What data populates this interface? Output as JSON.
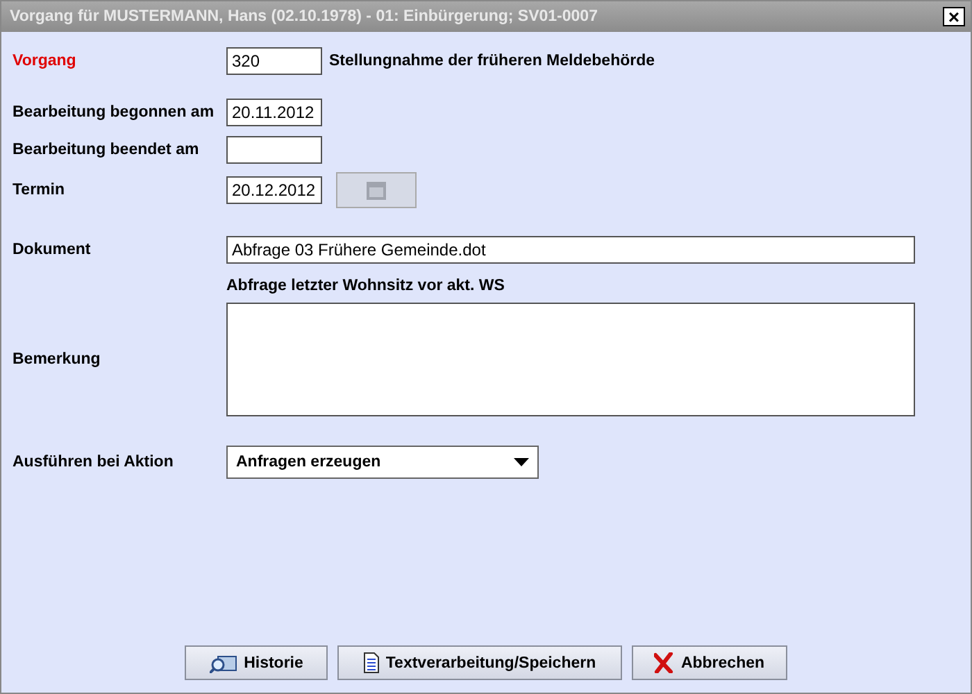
{
  "window": {
    "title": "Vorgang für MUSTERMANN, Hans (02.10.1978) - 01: Einbürgerung; SV01-0007",
    "close": "×"
  },
  "vorgang": {
    "label": "Vorgang",
    "value": "320",
    "description": "Stellungnahme der früheren Meldebehörde"
  },
  "begonnen": {
    "label": "Bearbeitung begonnen am",
    "value": "20.11.2012"
  },
  "beendet": {
    "label": "Bearbeitung beendet am"
  },
  "termin": {
    "label": "Termin",
    "value": "20.12.2012",
    "calendar_disabled": true
  },
  "dokument": {
    "label": "Dokument",
    "value": "Abfrage 03 Frühere Gemeinde.dot",
    "note": "Abfrage letzter Wohnsitz vor akt. WS"
  },
  "bemerkung": {
    "label": "Bemerkung"
  },
  "aktion": {
    "label": "Ausführen bei Aktion",
    "value": "Anfragen erzeugen"
  },
  "buttons": [
    {
      "kind": "history",
      "label": "Historie"
    },
    {
      "kind": "document",
      "label": "Textverarbeitung/Speichern"
    },
    {
      "kind": "cancel",
      "label": "Abbrechen"
    }
  ]
}
